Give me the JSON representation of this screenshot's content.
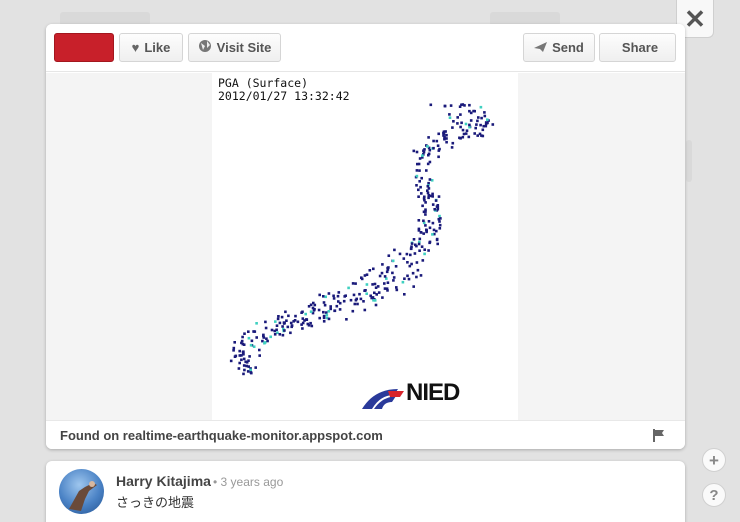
{
  "toolbar": {
    "pin_color": "#c8202a",
    "like_label": "Like",
    "visit_site_label": "Visit Site",
    "send_label": "Send",
    "share_label": "Share"
  },
  "icons": {
    "like": "heart-icon",
    "visit_site": "globe-icon",
    "send": "paper-plane-icon",
    "share": "share-icon",
    "close": "close-icon",
    "flag": "flag-icon",
    "zoom_in": "plus-icon",
    "help": "question-icon"
  },
  "overlay": {
    "close_label": "✕",
    "zoom_label": "+",
    "help_label": "?"
  },
  "pin": {
    "image_title_line1": "PGA (Surface)",
    "image_title_line2": "2012/01/27 13:32:42",
    "logo_text": "NIED",
    "found_on": "Found on realtime-earthquake-monitor.appspot.com"
  },
  "comment": {
    "name": "Harry Kitajima",
    "time": "• 3 years ago",
    "text": "さっきの地震"
  },
  "colors": {
    "station_dot": "#1a1a7a",
    "station_dot_active": "#3fd0c0",
    "logo_blue": "#2a3a9a",
    "logo_red": "#d8242c"
  }
}
